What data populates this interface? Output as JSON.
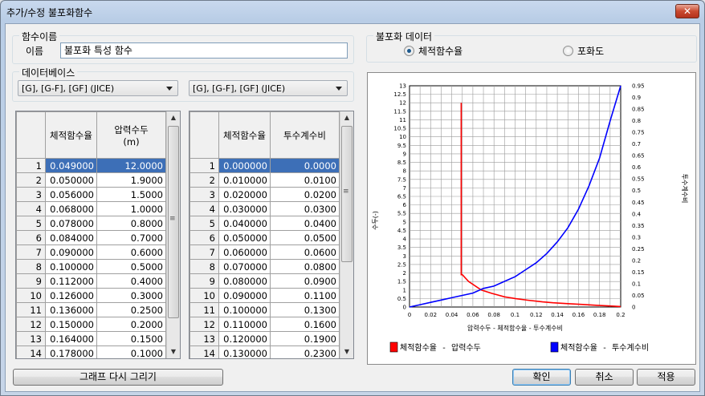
{
  "window": {
    "title": "추가/수정 불포화함수",
    "close_label": "✕"
  },
  "function_name_group": {
    "label": "함수이름",
    "name_label": "이름",
    "name_value": "불포화 특성 함수"
  },
  "unsat_data_group": {
    "label": "불포화 데이터",
    "option1": "체적함수율",
    "option2": "포화도",
    "selected": "체적함수율"
  },
  "database_group": {
    "label": "데이터베이스",
    "combo_left": "[G], [G-F], [GF] (JICE)",
    "combo_right": "[G], [G-F], [GF] (JICE)"
  },
  "left_table": {
    "headers": [
      "체적함수율",
      "압력수두\n(m)"
    ],
    "rows": [
      [
        "1",
        "0.049000",
        "12.0000"
      ],
      [
        "2",
        "0.050000",
        "1.9000"
      ],
      [
        "3",
        "0.056000",
        "1.5000"
      ],
      [
        "4",
        "0.068000",
        "1.0000"
      ],
      [
        "5",
        "0.078000",
        "0.8000"
      ],
      [
        "6",
        "0.084000",
        "0.7000"
      ],
      [
        "7",
        "0.090000",
        "0.6000"
      ],
      [
        "8",
        "0.100000",
        "0.5000"
      ],
      [
        "9",
        "0.112000",
        "0.4000"
      ],
      [
        "10",
        "0.126000",
        "0.3000"
      ],
      [
        "11",
        "0.136000",
        "0.2500"
      ],
      [
        "12",
        "0.150000",
        "0.2000"
      ],
      [
        "13",
        "0.164000",
        "0.1500"
      ],
      [
        "14",
        "0.178000",
        "0.1000"
      ]
    ]
  },
  "right_table": {
    "headers": [
      "체적함수율",
      "투수계수비"
    ],
    "rows": [
      [
        "1",
        "0.000000",
        "0.0000"
      ],
      [
        "2",
        "0.010000",
        "0.0100"
      ],
      [
        "3",
        "0.020000",
        "0.0200"
      ],
      [
        "4",
        "0.030000",
        "0.0300"
      ],
      [
        "5",
        "0.040000",
        "0.0400"
      ],
      [
        "6",
        "0.050000",
        "0.0500"
      ],
      [
        "7",
        "0.060000",
        "0.0600"
      ],
      [
        "8",
        "0.070000",
        "0.0800"
      ],
      [
        "9",
        "0.080000",
        "0.0900"
      ],
      [
        "10",
        "0.090000",
        "0.1100"
      ],
      [
        "11",
        "0.100000",
        "0.1300"
      ],
      [
        "12",
        "0.110000",
        "0.1600"
      ],
      [
        "13",
        "0.120000",
        "0.1900"
      ],
      [
        "14",
        "0.130000",
        "0.2300"
      ]
    ]
  },
  "chart_data": {
    "type": "line",
    "xlabel": "압력수두 - 체적함수율 - 투수계수비",
    "ylabel_left": "수두(-)",
    "ylabel_right": "투수계수비",
    "xlim": [
      0,
      0.2
    ],
    "x_ticks": [
      "0",
      "0.02",
      "0.04",
      "0.06",
      "0.08",
      "0.1",
      "0.12",
      "0.14",
      "0.16",
      "0.18",
      "0.2"
    ],
    "ylim_left": [
      0,
      13
    ],
    "y_ticks_left": [
      "0",
      "0.5",
      "1",
      "1.5",
      "2",
      "2.5",
      "3",
      "3.5",
      "4",
      "4.5",
      "5",
      "5.5",
      "6",
      "6.5",
      "7",
      "7.5",
      "8",
      "8.5",
      "9",
      "9.5",
      "10",
      "10.5",
      "11",
      "11.5",
      "12",
      "12.5",
      "13"
    ],
    "ylim_right": [
      0,
      0.95
    ],
    "y_ticks_right": [
      "0",
      "0.05",
      "0.1",
      "0.15",
      "0.2",
      "0.25",
      "0.3",
      "0.35",
      "0.4",
      "0.45",
      "0.5",
      "0.55",
      "0.6",
      "0.65",
      "0.7",
      "0.75",
      "0.8",
      "0.85",
      "0.9",
      "0.95"
    ],
    "series": [
      {
        "name": "체적함수율 - 압력수두",
        "color": "#ff0000",
        "axis": "left",
        "x": [
          0.049,
          0.05,
          0.056,
          0.068,
          0.078,
          0.084,
          0.09,
          0.1,
          0.112,
          0.126,
          0.136,
          0.15,
          0.164,
          0.178,
          0.19,
          0.2
        ],
        "y": [
          12.0,
          1.9,
          1.5,
          1.0,
          0.8,
          0.7,
          0.6,
          0.5,
          0.4,
          0.3,
          0.25,
          0.2,
          0.15,
          0.1,
          0.06,
          0.03
        ]
      },
      {
        "name": "체적함수율 - 투수계수비",
        "color": "#0000ff",
        "axis": "right",
        "x": [
          0,
          0.01,
          0.02,
          0.03,
          0.04,
          0.05,
          0.06,
          0.07,
          0.08,
          0.09,
          0.1,
          0.11,
          0.12,
          0.13,
          0.14,
          0.15,
          0.16,
          0.17,
          0.18,
          0.19,
          0.2
        ],
        "y": [
          0,
          0.01,
          0.02,
          0.03,
          0.04,
          0.05,
          0.06,
          0.08,
          0.09,
          0.11,
          0.13,
          0.16,
          0.19,
          0.23,
          0.28,
          0.34,
          0.42,
          0.52,
          0.64,
          0.8,
          0.98
        ]
      }
    ]
  },
  "buttons": {
    "redraw": "그래프 다시 그리기",
    "ok": "확인",
    "cancel": "취소",
    "apply": "적용"
  },
  "colors": {
    "selected_cell": "#3d6fb7",
    "red_series": "#ff0000",
    "blue_series": "#0000ff"
  }
}
